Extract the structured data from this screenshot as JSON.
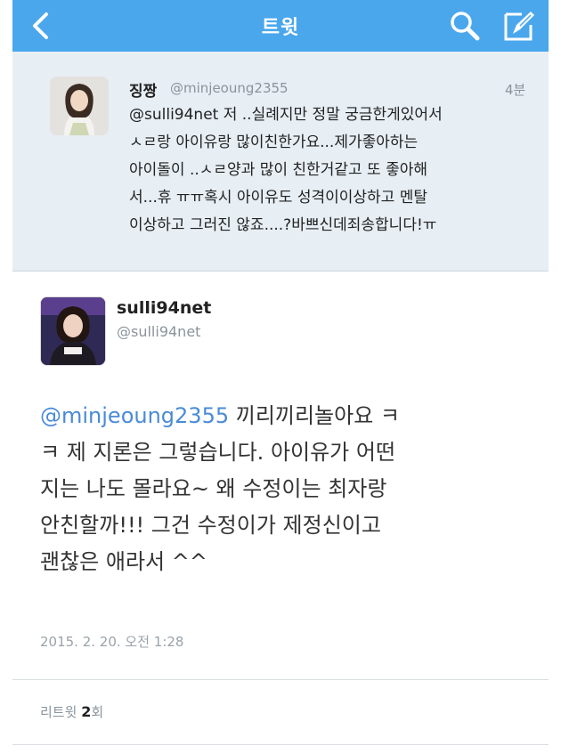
{
  "nav": {
    "title": "트윗",
    "back_icon": "chevron-left-icon",
    "search_icon": "search-icon",
    "compose_icon": "compose-icon",
    "bar_color": "#4aa7ec"
  },
  "reply": {
    "name": "징짱",
    "handle": "@minjeoung2355",
    "time": "4분",
    "lines": [
      "@sulli94net 저 ..실례지만 정말 궁금한게있어서",
      "ㅅㄹ랑 아이유랑 많이친한가요...제가좋아하는",
      "아이돌이 ..ㅅㄹ양과 많이 친한거같고 또 좋아해",
      "서...휴 ㅠㅠ혹시 아이유도 성격이이상하고 멘탈",
      "이상하고 그러진 않죠....?바쁘신데죄송합니다!ㅠ"
    ]
  },
  "tweet": {
    "name": "sulli94net",
    "handle": "@sulli94net",
    "mention": "@minjeoung2355",
    "line1_rest": " 끼리끼리놀아요 ㅋ",
    "lines": [
      "ㅋ 제 지론은 그렇습니다. 아이유가 어떤",
      "지는 나도 몰라요~ 왜 수정이는 최자랑",
      "안친할까!!! 그건 수정이가 제정신이고",
      "괜찮은 애라서 ^^"
    ],
    "date": "2015. 2. 20. 오전 1:28",
    "retweets_label": "리트윗",
    "retweets_count": "2",
    "retweets_suffix": "회",
    "mention_color": "#4a8bd6"
  }
}
